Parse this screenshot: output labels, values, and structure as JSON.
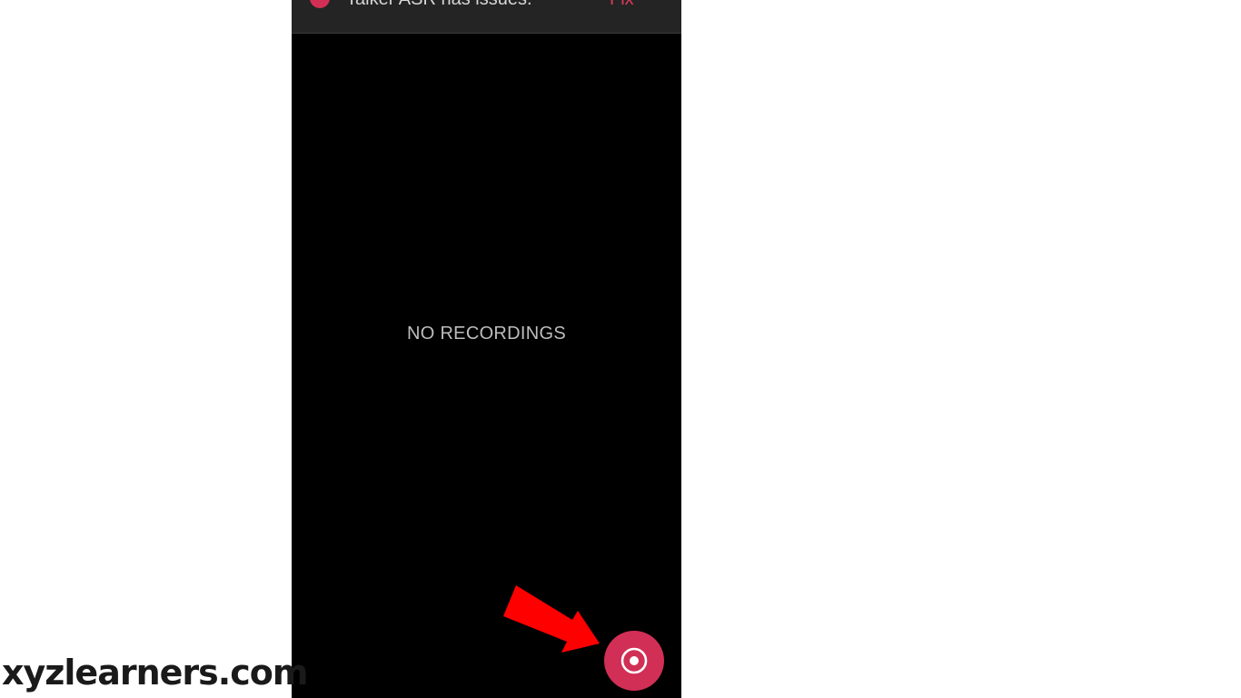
{
  "banner": {
    "message": "Talker ASR has issues.",
    "action_label": "Fix",
    "icon": "alert-icon"
  },
  "main": {
    "empty_message": "NO RECORDINGS"
  },
  "fab": {
    "icon": "record-icon"
  },
  "annotation": {
    "icon": "pointer-arrow-icon"
  },
  "watermark": {
    "text": "xyzlearners.com"
  },
  "colors": {
    "accent": "#d12f55",
    "annotation_arrow": "#ff0000",
    "background": "#000000",
    "banner_background": "#242424"
  }
}
